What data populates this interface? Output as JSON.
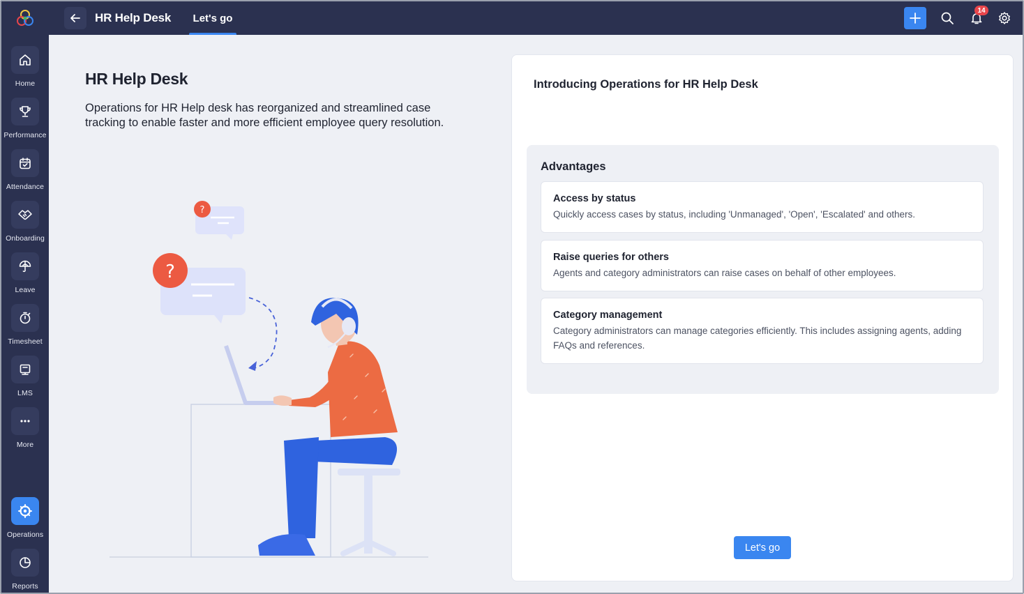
{
  "app": {
    "logo_icon": "zoho-people-logo-icon"
  },
  "sidebar": {
    "items": [
      {
        "label": "Home",
        "icon": "home-icon"
      },
      {
        "label": "Performance",
        "icon": "trophy-icon"
      },
      {
        "label": "Attendance",
        "icon": "calendar-check-icon"
      },
      {
        "label": "Onboarding",
        "icon": "handshake-icon"
      },
      {
        "label": "Leave",
        "icon": "umbrella-icon"
      },
      {
        "label": "Timesheet",
        "icon": "stopwatch-icon"
      },
      {
        "label": "LMS",
        "icon": "book-icon"
      },
      {
        "label": "More",
        "icon": "more-icon"
      },
      {
        "label": "Operations",
        "icon": "operations-icon",
        "active": true
      },
      {
        "label": "Reports",
        "icon": "pie-chart-icon"
      }
    ]
  },
  "topbar": {
    "title": "HR Help Desk",
    "tab": "Let's go",
    "notification_count": "14"
  },
  "intro": {
    "title": "HR Help Desk",
    "description": "Operations for HR Help desk has reorganized and streamlined case tracking to enable faster and more efficient employee query resolution."
  },
  "card": {
    "title": "Introducing Operations for HR Help Desk",
    "advantages_heading": "Advantages",
    "advantages": [
      {
        "title": "Access by status",
        "description": "Quickly access cases by status, including 'Unmanaged', 'Open', 'Escalated' and others."
      },
      {
        "title": "Raise queries for others",
        "description": "Agents and category administrators can raise cases on behalf of other employees."
      },
      {
        "title": "Category management",
        "description": "Category administrators can manage categories efficiently. This includes assigning agents, adding FAQs and references."
      }
    ],
    "button_label": "Let's go"
  },
  "colors": {
    "rail_bg": "#2b3150",
    "accent": "#3a86f0",
    "page_bg": "#eef0f5",
    "badge": "#e8454b"
  }
}
